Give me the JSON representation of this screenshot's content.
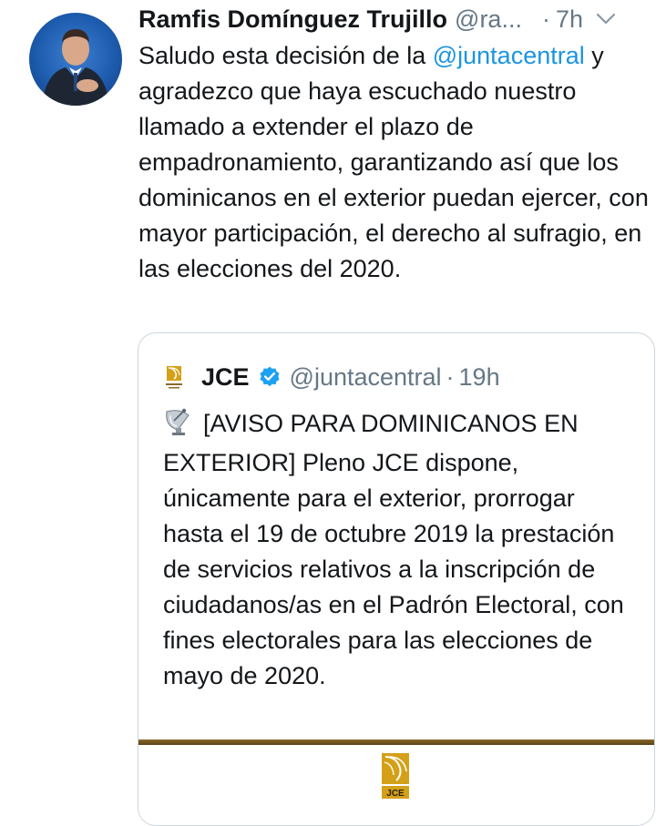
{
  "tweet": {
    "author_name": "Ramfis Domínguez Trujillo",
    "handle": "@ra...",
    "dot": "·",
    "time": "7h",
    "avatar_icon": "profile-photo",
    "menu_icon": "chevron-down-icon",
    "text_before": "Saludo esta decisión de la ",
    "mention": "@juntacentral",
    "text_after": " y agradezco que haya escuchado nuestro llamado a extender el plazo de empadronamiento, garantizando así que los dominicanos en el exterior puedan ejercer, con mayor participación, el derecho al sufragio, en las elecciones del 2020."
  },
  "quoted_tweet": {
    "author_name": "JCE",
    "handle": "@juntacentral",
    "dot": "·",
    "time": "19h",
    "verified_icon": "verified-badge-icon",
    "emoji_icon": "satellite-dish-icon",
    "text": "[AVISO PARA DOMINICANOS EN EXTERIOR] Pleno JCE dispone, únicamente para el exterior, prorrogar hasta el 19 de octubre 2019 la prestación de servicios relativos a la inscripción de ciudadanos/as en el Padrón Electoral, con fines electorales para las elecciones de mayo de 2020.",
    "media_logo_text": "JCE"
  },
  "colors": {
    "text": "#14171a",
    "secondary": "#657786",
    "link": "#1b95e0",
    "verified": "#1da1f2",
    "border": "#ccd6dd",
    "jce_gold": "#d4a017",
    "media_band": "#5a4217"
  }
}
